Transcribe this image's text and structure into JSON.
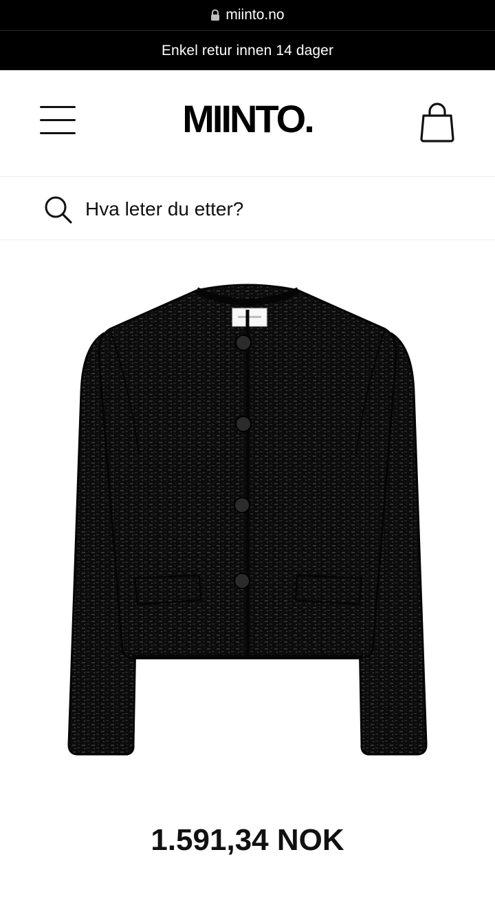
{
  "browser": {
    "url": "miinto.no"
  },
  "promo_banner": {
    "text": "Enkel retur innen 14 dager"
  },
  "header": {
    "logo": "MIINTO.",
    "menu_icon": "hamburger-menu-icon",
    "cart_icon": "shopping-bag-icon"
  },
  "search": {
    "placeholder": "Hva leter du etter?",
    "value": "",
    "icon": "search-icon"
  },
  "product": {
    "image_alt": "Black tweed cropped jacket",
    "price": "1.591,34 NOK"
  },
  "colors": {
    "banner_bg": "#000000",
    "banner_text": "#ffffff",
    "text": "#111111"
  }
}
